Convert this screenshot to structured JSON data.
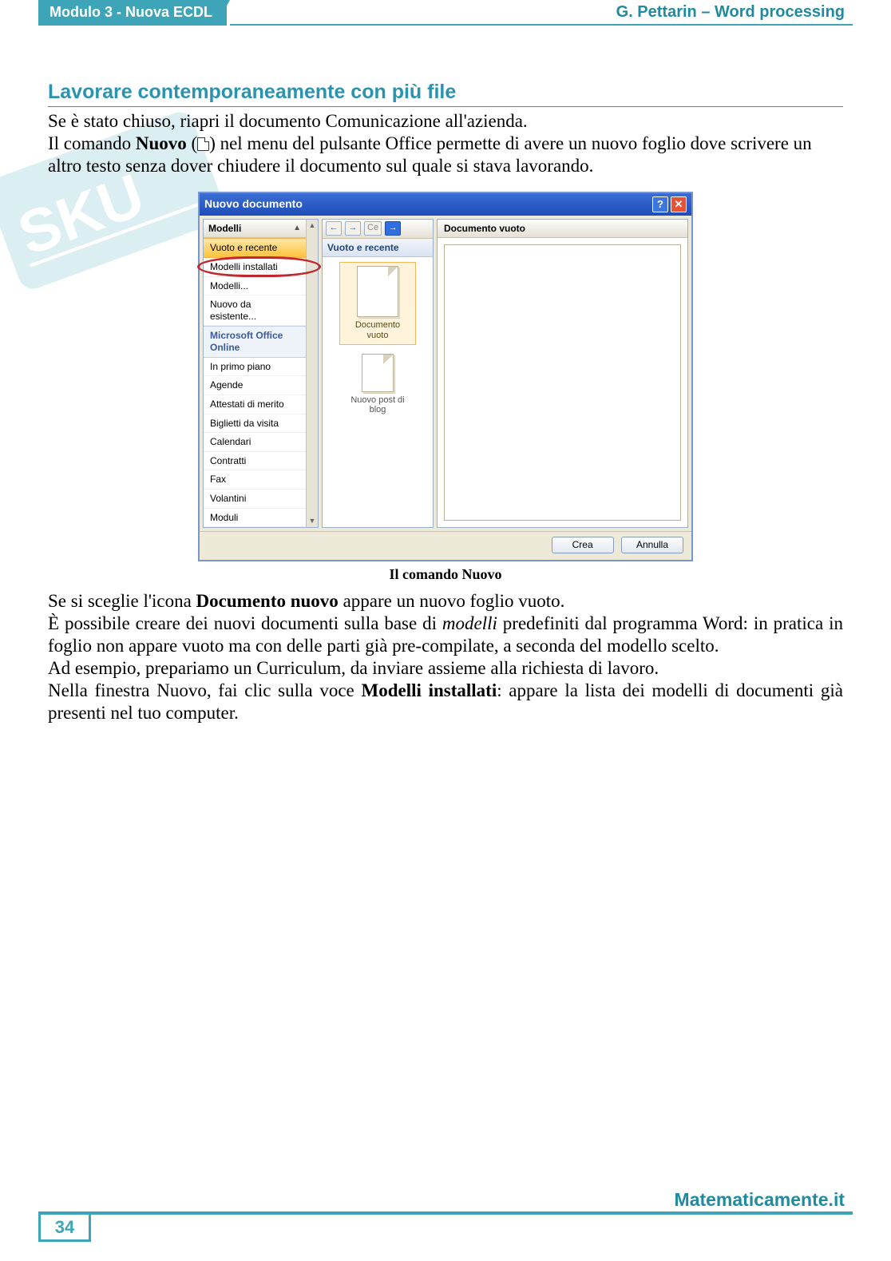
{
  "header": {
    "module": "Modulo 3 - Nuova ECDL",
    "author": "G. Pettarin – Word processing"
  },
  "section_title": "Lavorare contemporaneamente con più file",
  "para1_a": "Se è stato chiuso, riapri il documento Comunicazione all'azienda.",
  "para1_b_pre": "Il comando ",
  "para1_b_bold": "Nuovo",
  "para1_b_post": " (",
  "para1_b_post2": ") nel menu del pulsante Office permette di avere un nuovo foglio dove scrivere un altro testo senza dover chiudere il documento sul quale si stava lavorando.",
  "dialog": {
    "title": "Nuovo documento",
    "sidebar_header": "Modelli",
    "items": {
      "i0": "Vuoto e recente",
      "i1": "Modelli installati",
      "i2": "Modelli...",
      "i3": "Nuovo da esistente...",
      "sec": "Microsoft Office Online",
      "i4": "In primo piano",
      "i5": "Agende",
      "i6": "Attestati di merito",
      "i7": "Biglietti da visita",
      "i8": "Calendari",
      "i9": "Contratti",
      "i10": "Fax",
      "i11": "Volantini",
      "i12": "Moduli"
    },
    "toolbar_text": "Ce",
    "mid_section": "Vuoto e recente",
    "tile1": "Documento vuoto",
    "tile2": "Nuovo post di blog",
    "preview_title": "Documento vuoto",
    "btn_create": "Crea",
    "btn_cancel": "Annulla"
  },
  "caption": "Il comando Nuovo",
  "para2_a_pre": "Se si sceglie l'icona ",
  "para2_a_bold": "Documento nuovo",
  "para2_a_post": " appare un nuovo foglio vuoto.",
  "para2_b_pre": "È possibile creare dei nuovi documenti sulla base di ",
  "para2_b_em": "modelli",
  "para2_b_post": " predefiniti dal programma Word: in pratica in foglio non appare vuoto ma con delle parti già pre-compilate, a seconda del modello scelto.",
  "para2_c": "Ad esempio, prepariamo un Curriculum, da inviare assieme alla richiesta di lavoro.",
  "para2_d_pre": "Nella finestra Nuovo, fai clic sulla voce ",
  "para2_d_bold": "Modelli installati",
  "para2_d_post": ": appare la lista dei modelli di documenti già presenti nel tuo computer.",
  "footer": {
    "page": "34",
    "site": "Matematicamente.it"
  }
}
